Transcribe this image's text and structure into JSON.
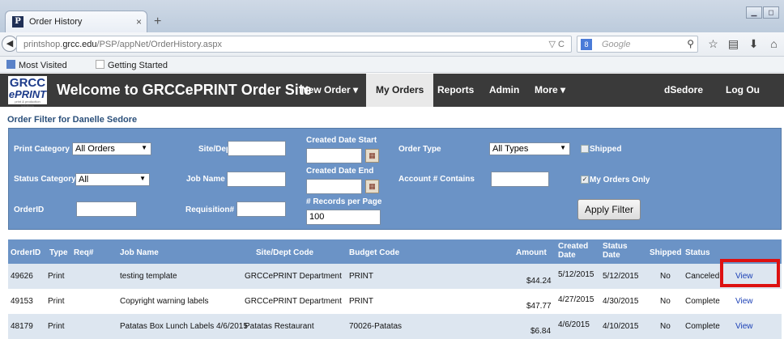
{
  "browser": {
    "tab_title": "Order History",
    "tab_close": "×",
    "new_tab": "+",
    "url_prefix": "printshop.",
    "url_domain": "grcc.edu",
    "url_path": "/PSP/appNet/OrderHistory.aspx",
    "reload_glyph": "▽ C",
    "search_engine": "8",
    "search_placeholder": "Google",
    "bookmarks": [
      "Most Visited",
      "Getting Started"
    ]
  },
  "site": {
    "logo_top": "GRCC",
    "logo_bottom": "ePRINT",
    "logo_tagline": "print & production solutions",
    "title": "Welcome to GRCCePRINT Order Site",
    "nav": [
      {
        "label": "New Order ▾"
      },
      {
        "label": "My Orders"
      },
      {
        "label": "Reports"
      },
      {
        "label": "Admin"
      },
      {
        "label": "More ▾"
      },
      {
        "label": "dSedore"
      },
      {
        "label": "Log Ou"
      }
    ]
  },
  "filter": {
    "title": "Order Filter for Danelle Sedore",
    "print_category_label": "Print Category",
    "print_category_value": "All Orders",
    "status_category_label": "Status Category",
    "status_category_value": "All",
    "orderid_label": "OrderID",
    "orderid_value": "",
    "site_dept_label": "Site/Dept",
    "site_dept_value": "",
    "job_name_label": "Job Name",
    "job_name_value": "",
    "requisition_label": "Requisition#",
    "requisition_value": "",
    "created_start_label": "Created Date Start",
    "created_end_label": "Created Date End",
    "records_label": "# Records per Page",
    "records_value": "100",
    "order_type_label": "Order Type",
    "order_type_value": "All Types",
    "account_label": "Account # Contains",
    "account_value": "",
    "shipped_label": "Shipped",
    "my_orders_label": "My Orders Only",
    "apply_label": "Apply Filter",
    "cal_glyph": "▦"
  },
  "table": {
    "headers": {
      "orderid": "OrderID",
      "type": "Type",
      "req": "Req#",
      "job": "Job Name",
      "site": "Site/Dept Code",
      "budget": "Budget Code",
      "amount": "Amount",
      "created": "Created Date",
      "status_date": "Status Date",
      "shipped": "Shipped",
      "status": "Status"
    },
    "rows": [
      {
        "orderid": "49626",
        "type": "Print",
        "job": "testing template",
        "site": "GRCCePRINT Department",
        "budget": "PRINT",
        "amount": "$44.24",
        "created": "5/12/2015",
        "status_date": "5/12/2015",
        "shipped": "No",
        "status": "Canceled",
        "action": "View"
      },
      {
        "orderid": "49153",
        "type": "Print",
        "job": "Copyright warning labels",
        "site": "GRCCePRINT Department",
        "budget": "PRINT",
        "amount": "$47.77",
        "created": "4/27/2015",
        "status_date": "4/30/2015",
        "shipped": "No",
        "status": "Complete",
        "action": "View"
      },
      {
        "orderid": "48179",
        "type": "Print",
        "job": "Patatas Box Lunch Labels 4/6/2015",
        "site": "Patatas Restaurant",
        "budget": "70026-Patatas",
        "amount": "$6.84",
        "created": "4/6/2015",
        "status_date": "4/10/2015",
        "shipped": "No",
        "status": "Complete",
        "action": "View"
      }
    ]
  },
  "colors": {
    "panel": "#6b93c6",
    "nav": "#3a3a3a",
    "highlight": "#dd1111",
    "link": "#1a3fb5"
  }
}
